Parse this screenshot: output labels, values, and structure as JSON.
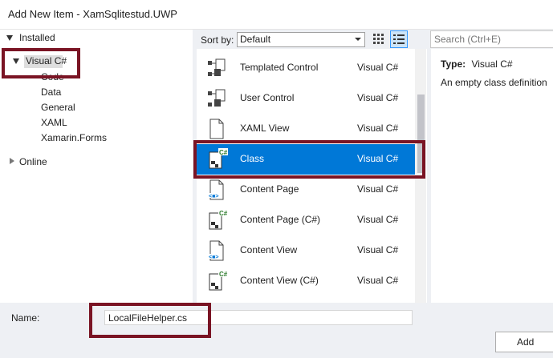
{
  "window": {
    "title": "Add New Item - XamSqlitestud.UWP"
  },
  "tree": {
    "installed_label": "Installed",
    "selected_label": "Visual C#",
    "children": [
      "Code",
      "Data",
      "General",
      "XAML",
      "Xamarin.Forms"
    ],
    "online_label": "Online"
  },
  "toolbar": {
    "sort_label": "Sort by:",
    "sort_value": "Default",
    "search_placeholder": "Search (Ctrl+E)"
  },
  "templates": [
    {
      "name": "Templated Control",
      "lang": "Visual C#",
      "icon": "templated-control-icon"
    },
    {
      "name": "User Control",
      "lang": "Visual C#",
      "icon": "user-control-icon"
    },
    {
      "name": "XAML View",
      "lang": "Visual C#",
      "icon": "xaml-view-icon"
    },
    {
      "name": "Class",
      "lang": "Visual C#",
      "icon": "class-csharp-icon"
    },
    {
      "name": "Content Page",
      "lang": "Visual C#",
      "icon": "content-page-icon"
    },
    {
      "name": "Content Page (C#)",
      "lang": "Visual C#",
      "icon": "content-page-csharp-icon"
    },
    {
      "name": "Content View",
      "lang": "Visual C#",
      "icon": "content-view-icon"
    },
    {
      "name": "Content View (C#)",
      "lang": "Visual C#",
      "icon": "content-view-csharp-icon"
    }
  ],
  "details": {
    "type_label": "Type:",
    "type_value": "Visual C#",
    "description": "An empty class definition"
  },
  "footer": {
    "name_label": "Name:",
    "name_value": "LocalFileHelper.cs",
    "add_label": "Add"
  },
  "colors": {
    "selection": "#0078d7",
    "highlight_box": "#7a1424"
  }
}
